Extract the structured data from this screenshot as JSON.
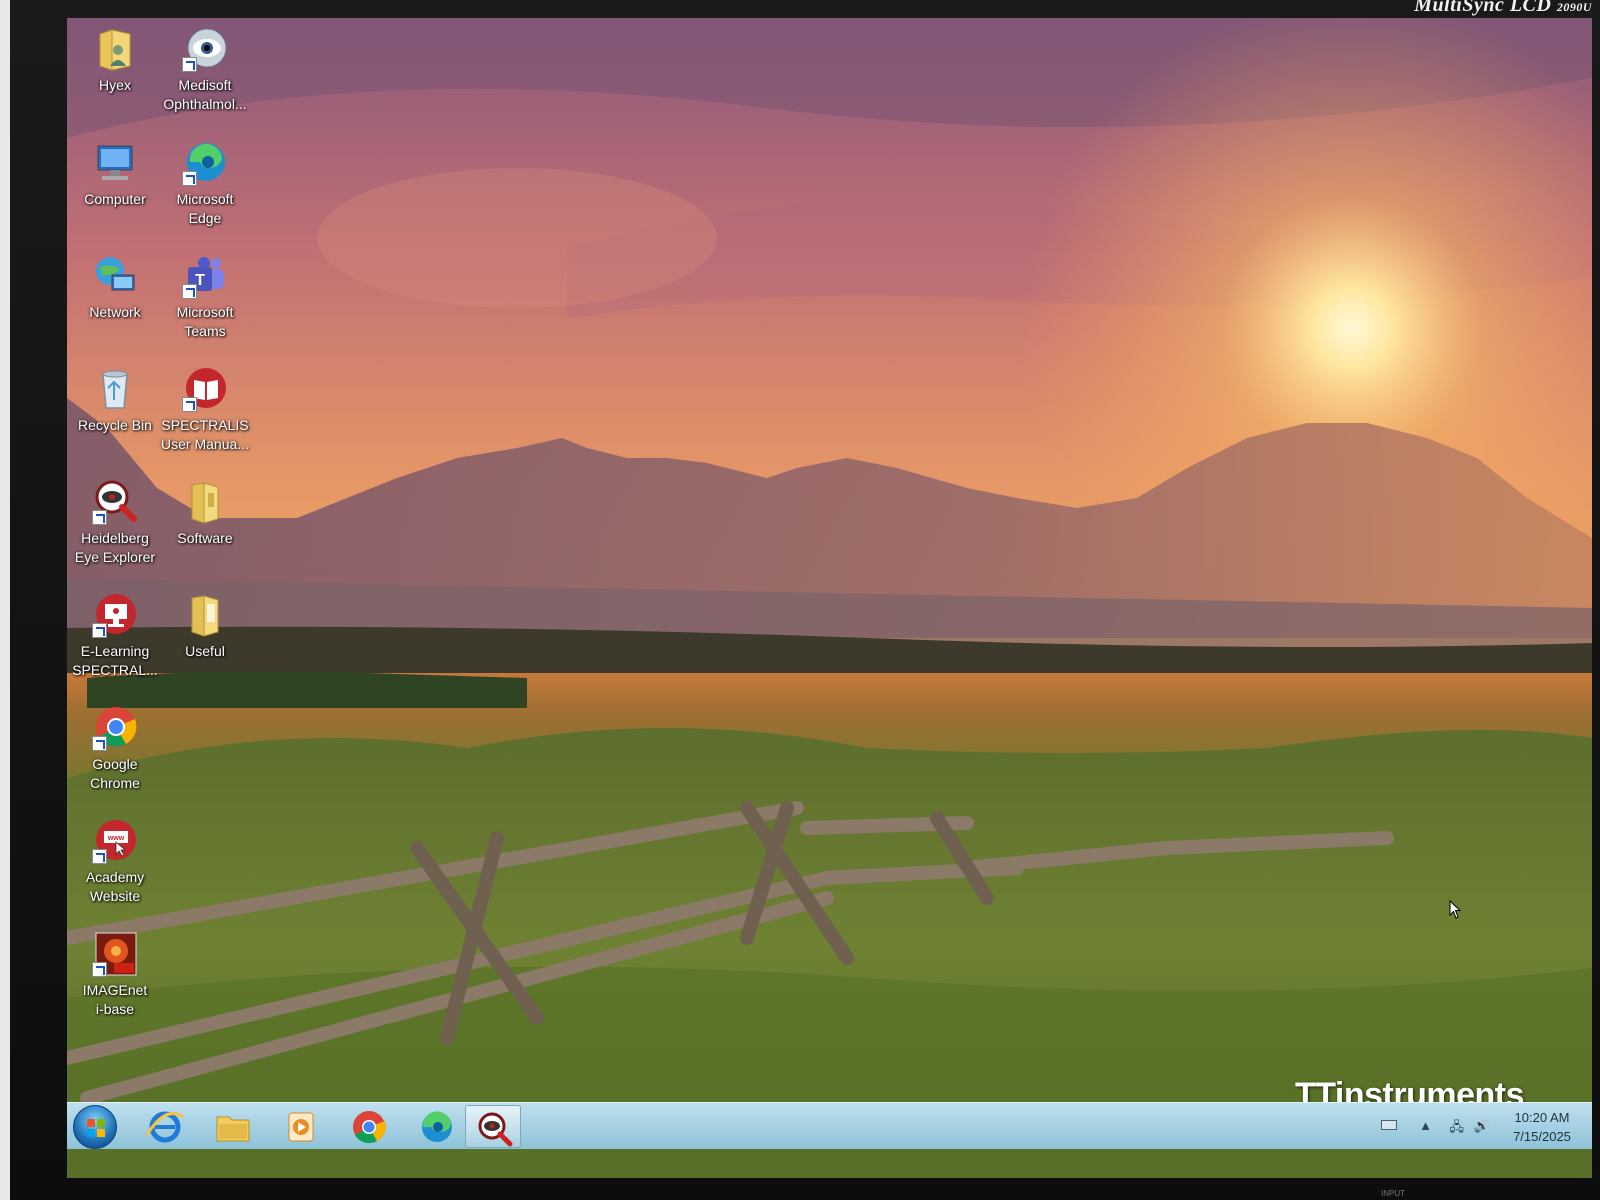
{
  "monitor": {
    "brand": "MultiSync LCD",
    "model": "2090U",
    "input_label": "INPUT"
  },
  "desktop_icons": [
    {
      "label": "Hyex"
    },
    {
      "label": "Medisoft\nOphthalmol..."
    },
    {
      "label": "Computer"
    },
    {
      "label": "Microsoft\nEdge"
    },
    {
      "label": "Network"
    },
    {
      "label": "Microsoft\nTeams"
    },
    {
      "label": "Recycle Bin"
    },
    {
      "label": "SPECTRALIS\nUser Manua..."
    },
    {
      "label": "Heidelberg\nEye Explorer"
    },
    {
      "label": "Software"
    },
    {
      "label": "E-Learning\nSPECTRAL..."
    },
    {
      "label": "Useful"
    },
    {
      "label": "Google\nChrome"
    },
    {
      "label": "Academy\nWebsite"
    },
    {
      "label": "IMAGEnet\ni-base"
    }
  ],
  "watermark": "TTinstruments",
  "taskbar": {
    "pinned": [
      "Internet Explorer",
      "Windows Explorer",
      "Windows Media Player",
      "Google Chrome",
      "Microsoft Edge",
      "Heidelberg Eye Explorer"
    ],
    "clock": {
      "time": "10:20 AM",
      "date": "7/15/2025"
    }
  }
}
